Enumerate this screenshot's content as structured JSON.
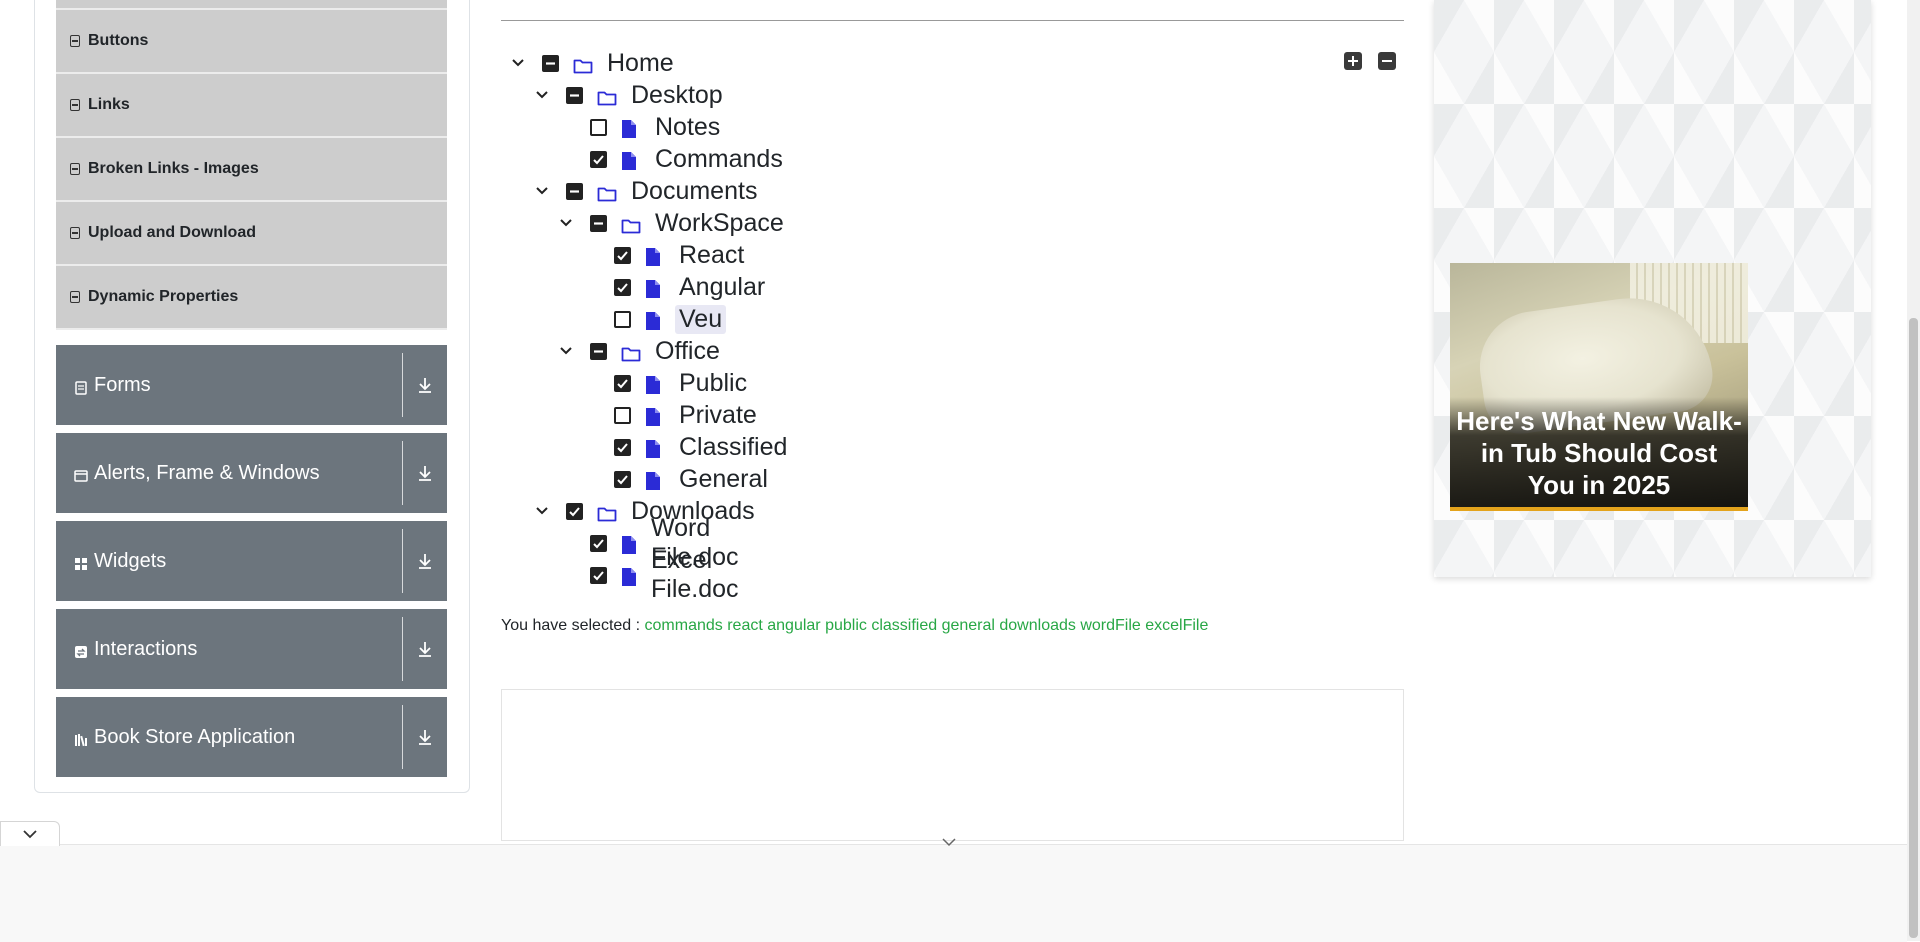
{
  "sidebar": {
    "sub_items": [
      {
        "label": ""
      },
      {
        "label": "Buttons"
      },
      {
        "label": "Links"
      },
      {
        "label": "Broken Links - Images"
      },
      {
        "label": "Upload and Download"
      },
      {
        "label": "Dynamic Properties"
      }
    ],
    "groups": [
      {
        "label": "Forms",
        "icon": "form-icon"
      },
      {
        "label": "Alerts, Frame & Windows",
        "icon": "window-icon"
      },
      {
        "label": "Widgets",
        "icon": "widgets-icon"
      },
      {
        "label": "Interactions",
        "icon": "interactions-icon"
      },
      {
        "label": "Book Store Application",
        "icon": "books-icon"
      }
    ]
  },
  "tree": {
    "nodes": [
      {
        "label": "Home",
        "type": "folder",
        "state": "half",
        "expanded": true
      },
      {
        "label": "Desktop",
        "type": "folder",
        "state": "half",
        "expanded": true
      },
      {
        "label": "Notes",
        "type": "file",
        "state": "unchecked"
      },
      {
        "label": "Commands",
        "type": "file",
        "state": "checked"
      },
      {
        "label": "Documents",
        "type": "folder",
        "state": "half",
        "expanded": true
      },
      {
        "label": "WorkSpace",
        "type": "folder",
        "state": "half",
        "expanded": true
      },
      {
        "label": "React",
        "type": "file",
        "state": "checked"
      },
      {
        "label": "Angular",
        "type": "file",
        "state": "checked"
      },
      {
        "label": "Veu",
        "type": "file",
        "state": "unchecked"
      },
      {
        "label": "Office",
        "type": "folder",
        "state": "half",
        "expanded": true
      },
      {
        "label": "Public",
        "type": "file",
        "state": "checked"
      },
      {
        "label": "Private",
        "type": "file",
        "state": "unchecked"
      },
      {
        "label": "Classified",
        "type": "file",
        "state": "checked"
      },
      {
        "label": "General",
        "type": "file",
        "state": "checked"
      },
      {
        "label": "Downloads",
        "type": "folder",
        "state": "checked",
        "expanded": true
      },
      {
        "label": "Word File.doc",
        "type": "file",
        "state": "checked"
      },
      {
        "label": "Excel File.doc",
        "type": "file",
        "state": "checked"
      }
    ]
  },
  "result": {
    "prefix": "You have selected :",
    "values": "commands react angular public classified general downloads wordFile excelFile"
  },
  "ad": {
    "caption": "Here's What New Walk-in Tub Should Cost You in 2025"
  },
  "colors": {
    "group_bg": "#6c757d",
    "sub_item_bg": "#cdcdcd",
    "selected_text": "#28a745",
    "icon_blue": "#2b2bd6"
  }
}
